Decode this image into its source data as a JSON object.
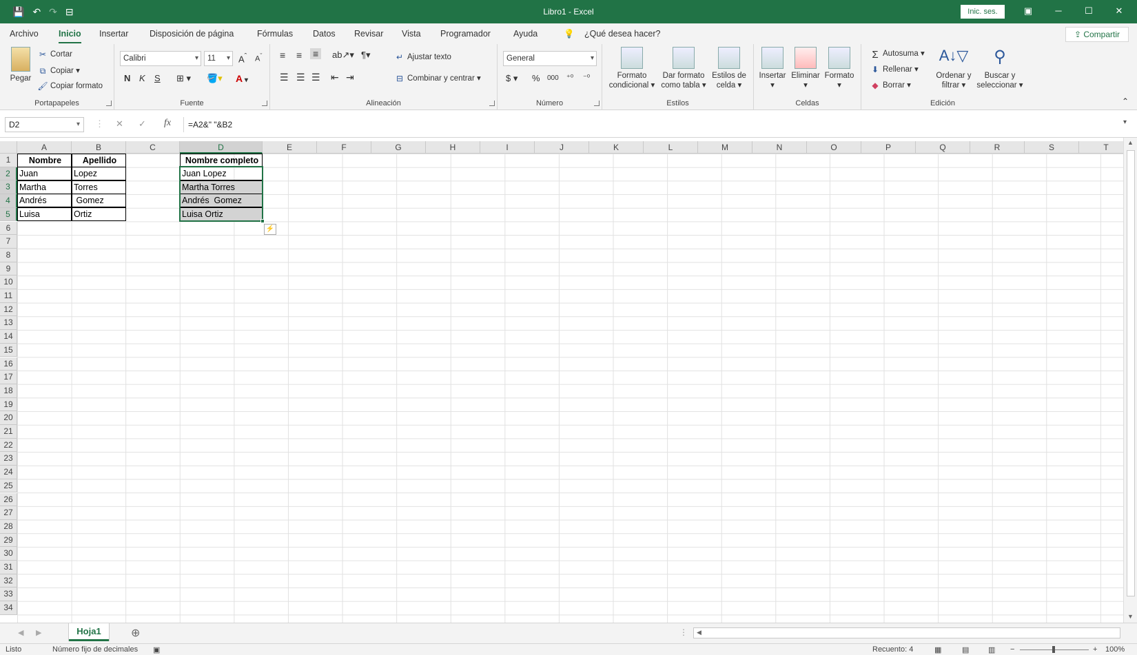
{
  "window": {
    "title": "Libro1  -  Excel",
    "signin_label": "Inic. ses.",
    "minimize_icon": "─",
    "restore_icon": "❐",
    "maximize_icon": "☐",
    "close_icon": "✕"
  },
  "qat": {
    "save_icon": "💾",
    "undo_icon": "↶",
    "redo_icon": "↷",
    "customize_icon": "⊟"
  },
  "menu": {
    "items": [
      "Archivo",
      "Inicio",
      "Insertar",
      "Disposición de página",
      "Fórmulas",
      "Datos",
      "Revisar",
      "Vista",
      "Programador",
      "Ayuda"
    ],
    "active": "Inicio",
    "tell_me": "¿Qué desea hacer?",
    "share": "Compartir"
  },
  "ribbon": {
    "clipboard": {
      "label": "Portapapeles",
      "paste": "Pegar",
      "cut": "Cortar",
      "copy": "Copiar",
      "format_painter": "Copiar formato"
    },
    "font": {
      "label": "Fuente",
      "font_name": "Calibri",
      "font_size": "11",
      "bold": "N",
      "italic": "K",
      "underline": "S"
    },
    "alignment": {
      "label": "Alineación",
      "wrap": "Ajustar texto",
      "merge": "Combinar y centrar"
    },
    "number": {
      "label": "Número",
      "format": "General",
      "currency": "$",
      "percent": "%",
      "thousands": "000"
    },
    "styles": {
      "label": "Estilos",
      "conditional": "Formato condicional",
      "as_table": "Dar formato como tabla",
      "cell_styles": "Estilos de celda"
    },
    "cells": {
      "label": "Celdas",
      "insert": "Insertar",
      "delete": "Eliminar",
      "format": "Formato"
    },
    "editing": {
      "label": "Edición",
      "autosum": "Autosuma",
      "fill": "Rellenar",
      "clear": "Borrar",
      "sort": "Ordenar y filtrar",
      "find": "Buscar y seleccionar"
    }
  },
  "formula_bar": {
    "name_box": "D2",
    "cancel": "✕",
    "enter": "✓",
    "fx": "fx",
    "formula": "=A2&\" \"&B2"
  },
  "columns": [
    "A",
    "B",
    "C",
    "D",
    "E",
    "F",
    "G",
    "H",
    "I",
    "J",
    "K",
    "L",
    "M",
    "N",
    "O",
    "P",
    "Q",
    "R",
    "S",
    "T"
  ],
  "rows": [
    "1",
    "2",
    "3",
    "4",
    "5",
    "6",
    "7",
    "8",
    "9",
    "10",
    "11",
    "12",
    "13",
    "14",
    "15",
    "16",
    "17",
    "18",
    "19",
    "20",
    "21",
    "22",
    "23",
    "24",
    "25",
    "26",
    "27",
    "28",
    "29",
    "30",
    "31",
    "32",
    "33",
    "34"
  ],
  "cells": {
    "A1": "Nombre",
    "B1": "Apellido",
    "D1": "Nombre completo",
    "A2": "Juan",
    "B2": "Lopez",
    "D2": "Juan Lopez",
    "A3": "Martha",
    "B3": "Torres",
    "D3": "Martha Torres",
    "A4": "Andrés",
    "B4": " Gomez",
    "D4": "Andrés  Gomez",
    "A5": "Luisa",
    "B5": "Ortiz",
    "D5": "Luisa Ortiz"
  },
  "sheet_tabs": {
    "active": "Hoja1",
    "add_icon": "⊕"
  },
  "status": {
    "ready": "Listo",
    "fixed_decimal": "Número fijo de decimales",
    "count": "Recuento: 4",
    "zoom": "100%"
  }
}
